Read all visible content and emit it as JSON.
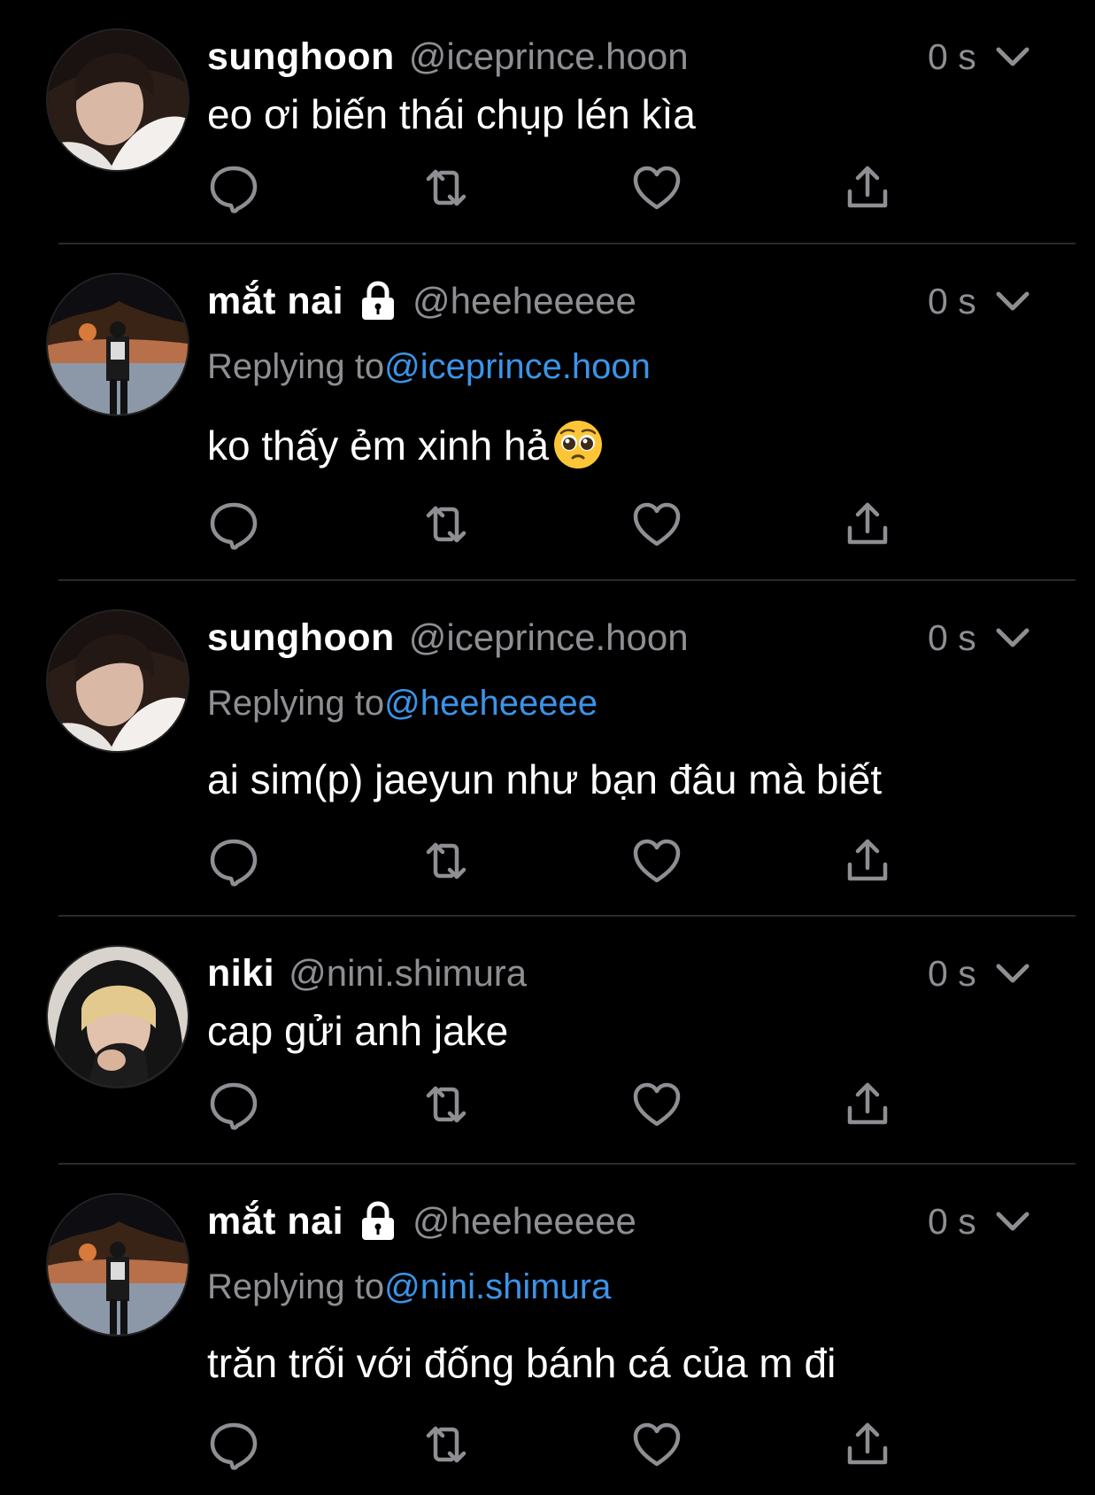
{
  "tweets": [
    {
      "name": "sunghoon",
      "handle": "@iceprince.hoon",
      "time": "0 s",
      "replying_label": "",
      "replying_to": "",
      "text": "eo ơi biến thái chụp lén kìa",
      "locked": false
    },
    {
      "name": "mắt nai",
      "handle": "@heeheeeee",
      "time": "0 s",
      "replying_label": "Replying to",
      "replying_to": "@iceprince.hoon",
      "text": "ko thấy ẻm xinh hả",
      "locked": true,
      "emoji": "pleading-face"
    },
    {
      "name": "sunghoon",
      "handle": "@iceprince.hoon",
      "time": "0 s",
      "replying_label": "Replying to",
      "replying_to": "@heeheeeee",
      "text": "ai sim(p) jaeyun như bạn đâu mà biết",
      "locked": false
    },
    {
      "name": "niki",
      "handle": "@nini.shimura",
      "time": "0 s",
      "replying_label": "",
      "replying_to": "",
      "text": "cap gửi anh jake",
      "locked": false
    },
    {
      "name": "mắt nai",
      "handle": "@heeheeeee",
      "time": "0 s",
      "replying_label": "Replying to",
      "replying_to": "@nini.shimura",
      "text": "trăn trối với đống bánh cá của m đi",
      "locked": true
    }
  ],
  "icons": [
    "comment-icon",
    "retweet-icon",
    "like-icon",
    "share-icon",
    "chevron-down-icon",
    "lock-icon"
  ],
  "colors": {
    "background": "#000000",
    "text": "#ffffff",
    "muted": "#8e8e93",
    "link": "#3b94e8",
    "divider": "#2a2a2a"
  }
}
